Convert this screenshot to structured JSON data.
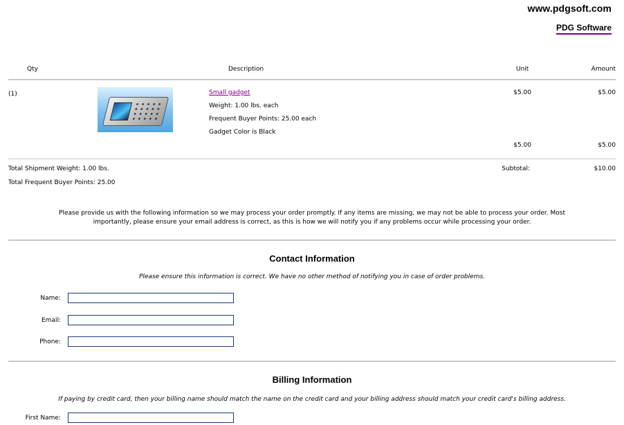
{
  "header": {
    "site_url": "www.pdgsoft.com",
    "site_name": "PDG Software"
  },
  "cart": {
    "columns": {
      "qty": "Qty",
      "description": "Description",
      "unit": "Unit",
      "amount": "Amount"
    },
    "item": {
      "qty": "(1)",
      "image_alt": "Small gadget image",
      "name": "Small gadget",
      "weight": "Weight: 1.00 lbs. each",
      "points": "Frequent Buyer Points: 25.00 each",
      "option": "Gadget Color is Black",
      "unit": "$5.00",
      "amount": "$5.00",
      "option_unit": "$5.00",
      "option_amount": "$5.00"
    },
    "totals": {
      "shipment_weight": "Total Shipment Weight: 1.00 lbs.",
      "buyer_points": "Total Frequent Buyer Points: 25.00",
      "subtotal_label": "Subtotal:",
      "subtotal_value": "$10.00"
    }
  },
  "notice": {
    "line1": "Please provide us with the following information so we may process your order promptly. If any items are missing, we may not be able to process your order. Most",
    "line2": "importantly, please ensure your email address is correct, as this is how we will notify you if any problems occur while processing your order."
  },
  "contact": {
    "title": "Contact Information",
    "note": "Please ensure this information is correct. We have no other method of notifying you in case of order problems.",
    "fields": {
      "name_label": "Name:",
      "name_value": "",
      "email_label": "Email:",
      "email_value": "",
      "phone_label": "Phone:",
      "phone_value": ""
    }
  },
  "billing": {
    "title": "Billing Information",
    "note": "If paying by credit card, then your billing name should match the name on the credit card and your billing address should match your credit card's billing address.",
    "fields": {
      "first_name_label": "First Name:",
      "first_name_value": ""
    }
  },
  "colors": {
    "link_visited": "#800080",
    "rule": "#c8c8c8",
    "input_border": "#1a3a78"
  },
  "icons": {
    "product_image": "handheld-gadget-image"
  }
}
